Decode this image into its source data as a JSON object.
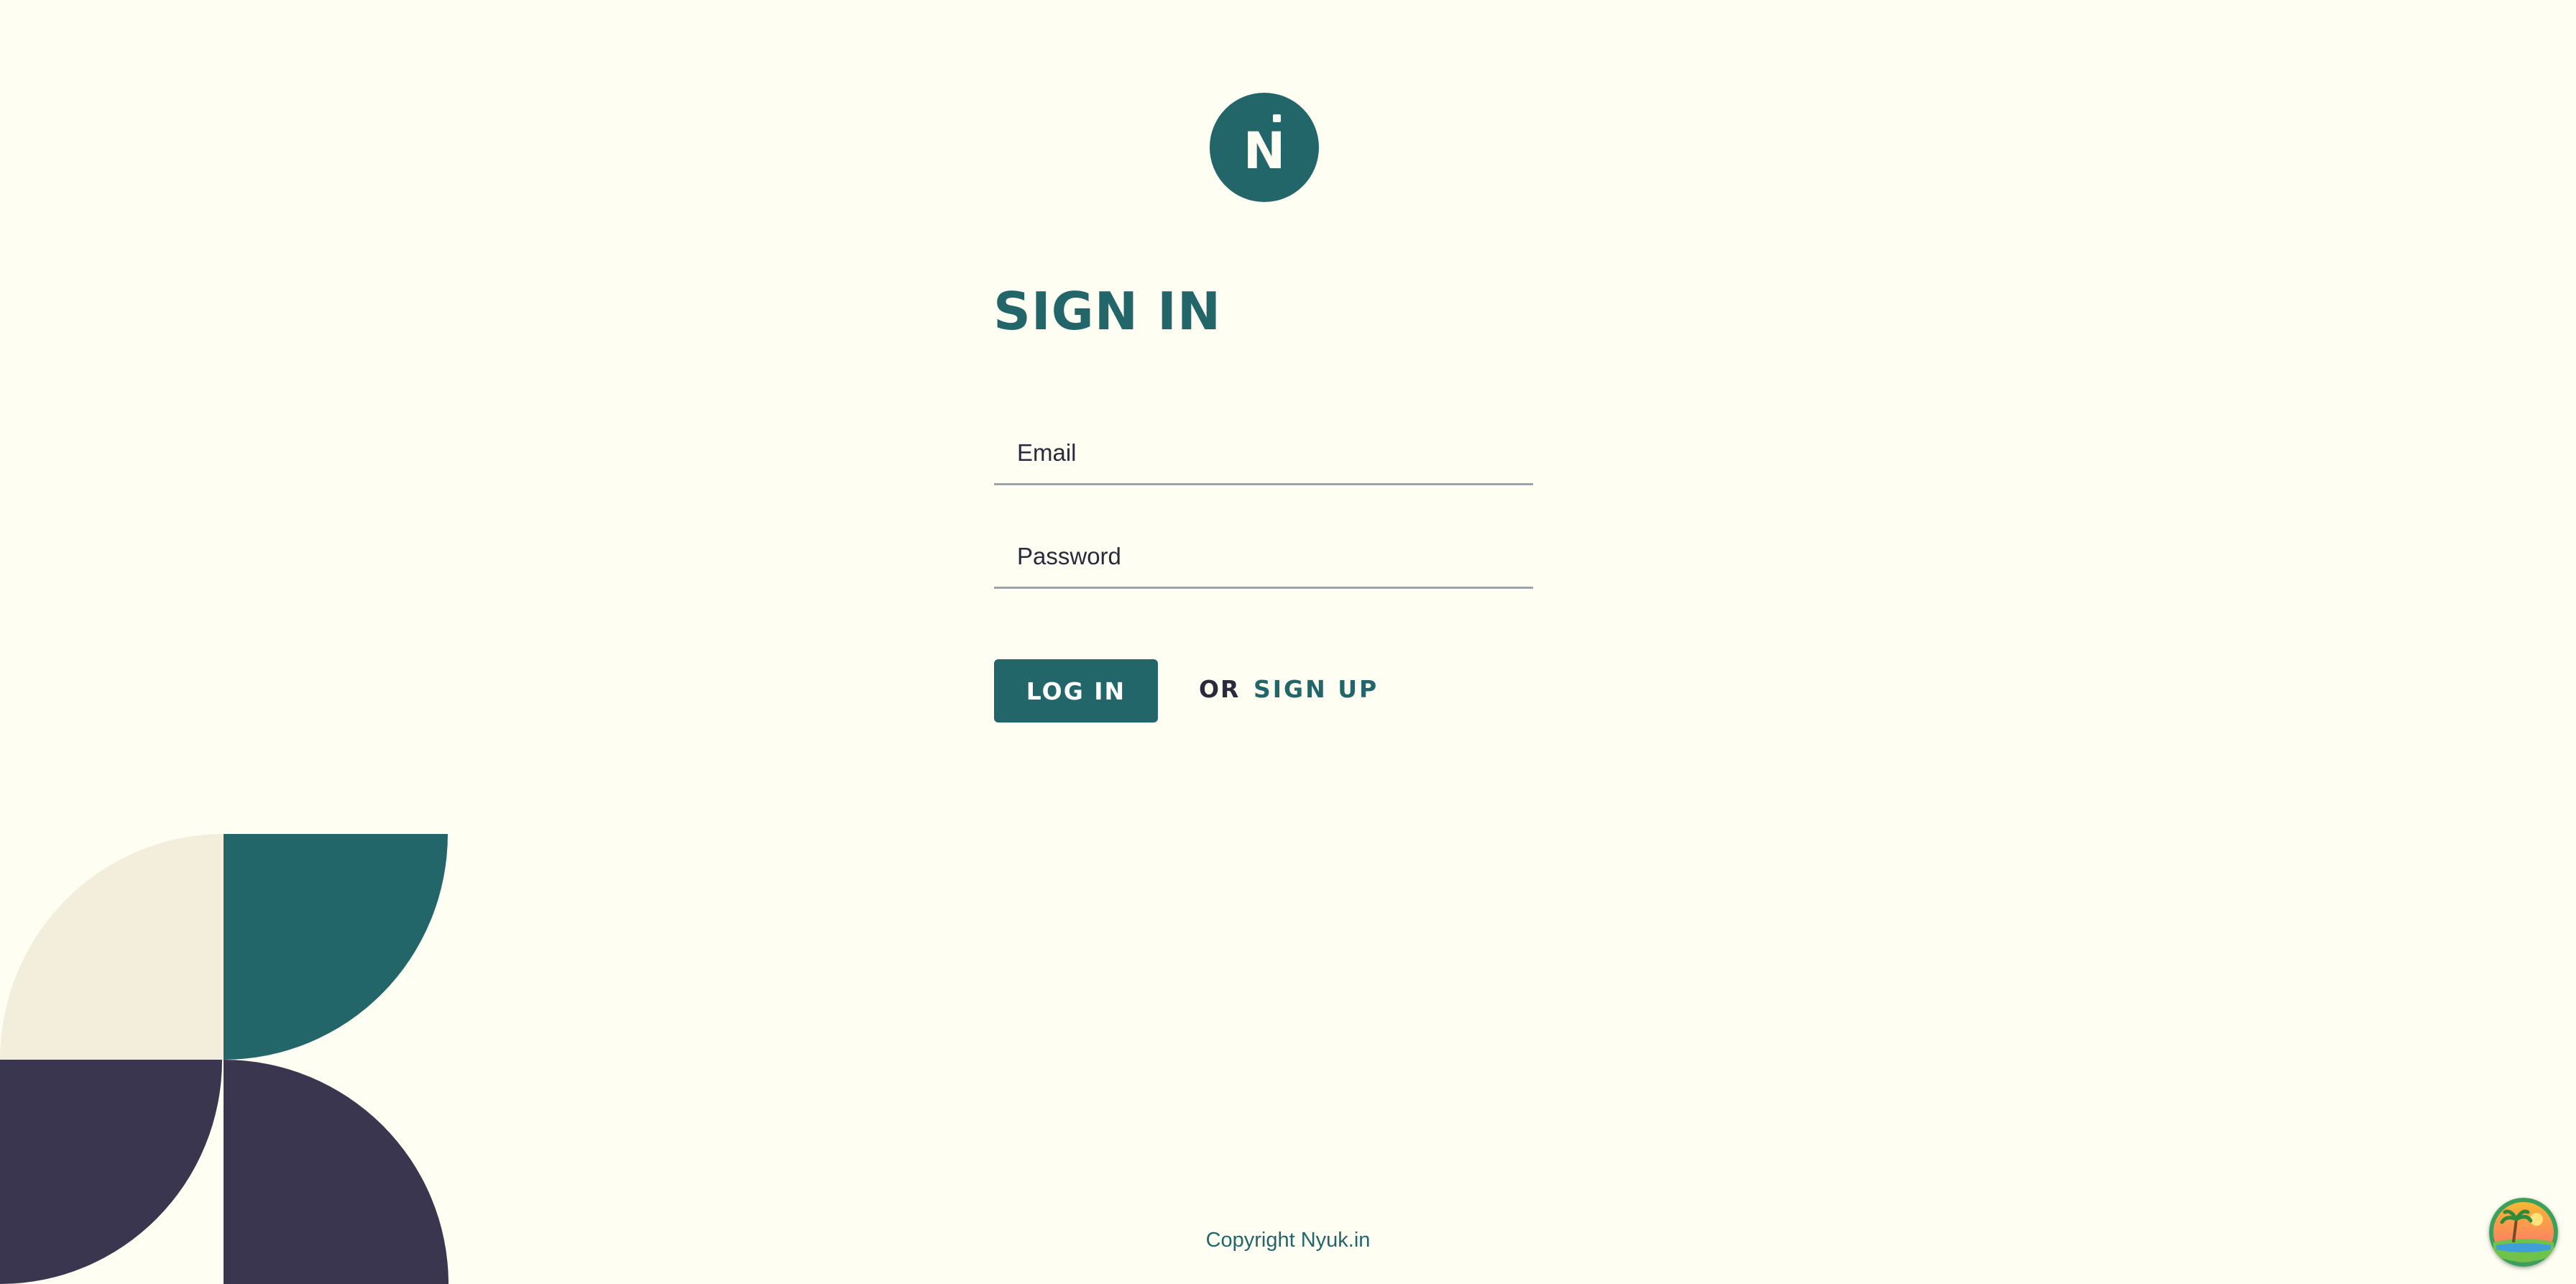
{
  "brand": {
    "logo_letter": "N",
    "primary_color": "#22666a",
    "dark_color": "#3a3650",
    "cream_color": "#f2eedb",
    "background_color": "#fefef3"
  },
  "page": {
    "title": "SIGN IN"
  },
  "form": {
    "email_placeholder": "Email",
    "password_placeholder": "Password",
    "login_label": "LOG IN",
    "or_label": "OR",
    "signup_label": "SIGN UP"
  },
  "footer": {
    "copyright": "Copyright Nyuk.in"
  },
  "floating_widget": {
    "icon": "beach-scene-icon"
  }
}
